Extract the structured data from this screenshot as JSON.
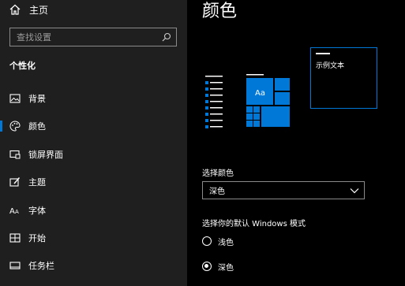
{
  "sidebar": {
    "home_label": "主页",
    "search_placeholder": "查找设置",
    "section_title": "个性化",
    "items": [
      {
        "label": "背景",
        "icon": "picture-icon"
      },
      {
        "label": "颜色",
        "icon": "palette-icon",
        "selected": true
      },
      {
        "label": "锁屏界面",
        "icon": "lock-screen-icon"
      },
      {
        "label": "主题",
        "icon": "theme-brush-icon"
      },
      {
        "label": "字体",
        "icon": "font-icon"
      },
      {
        "label": "开始",
        "icon": "start-icon"
      },
      {
        "label": "任务栏",
        "icon": "taskbar-icon"
      }
    ]
  },
  "main": {
    "title": "颜色",
    "preview": {
      "tile_text": "Aa",
      "sample_text": "示例文本"
    },
    "choose_color_label": "选择颜色",
    "choose_color_value": "深色",
    "windows_mode_label": "选择你的默认 Windows 模式",
    "mode_options": [
      {
        "label": "浅色",
        "selected": false
      },
      {
        "label": "深色",
        "selected": true
      }
    ]
  },
  "colors": {
    "accent": "#0078d7",
    "sidebar_bg": "#1f1f1f",
    "main_bg": "#000000"
  }
}
